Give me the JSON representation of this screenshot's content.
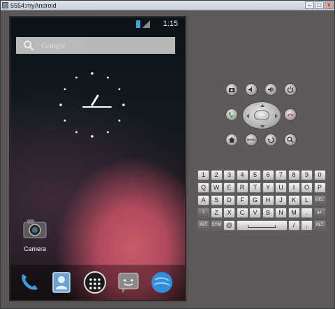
{
  "window": {
    "title": "5554:myAndroid"
  },
  "status_bar": {
    "time": "1:15"
  },
  "search": {
    "label": "Google"
  },
  "home": {
    "apps": [
      {
        "label": "Camera",
        "icon": "camera-icon"
      }
    ],
    "dock": [
      {
        "icon": "phone-icon"
      },
      {
        "icon": "contacts-icon"
      },
      {
        "icon": "all-apps-icon"
      },
      {
        "icon": "messaging-icon"
      },
      {
        "icon": "browser-icon"
      }
    ]
  },
  "controls": {
    "hardware_buttons": [
      {
        "icon": "camera-icon"
      },
      {
        "icon": "volume-down-icon"
      },
      {
        "icon": "volume-up-icon"
      },
      {
        "icon": "power-icon"
      },
      {
        "icon": "call-icon"
      },
      {
        "icon": "end-call-icon"
      },
      {
        "icon": "home-icon"
      },
      {
        "label": "MENU",
        "icon": "menu-icon"
      },
      {
        "icon": "back-icon"
      },
      {
        "icon": "search-icon"
      }
    ],
    "keyboard": {
      "row1": [
        "1",
        "2",
        "3",
        "4",
        "5",
        "6",
        "7",
        "8",
        "9",
        "0"
      ],
      "row2": [
        "Q",
        "W",
        "E",
        "R",
        "T",
        "Y",
        "U",
        "I",
        "O",
        "P"
      ],
      "row3": [
        "A",
        "S",
        "D",
        "F",
        "G",
        "H",
        "J",
        "K",
        "L",
        "DEL"
      ],
      "row4": [
        "Z",
        "X",
        "C",
        "V",
        "B",
        "N",
        "M",
        ".",
        "↵"
      ],
      "row5": [
        "ALT",
        "SYM",
        "@",
        "/",
        ",",
        "ALT"
      ]
    }
  },
  "colors": {
    "accent": "#c95a6a",
    "panel": "#5e5a5a",
    "status_accent": "#3aa3e0"
  }
}
